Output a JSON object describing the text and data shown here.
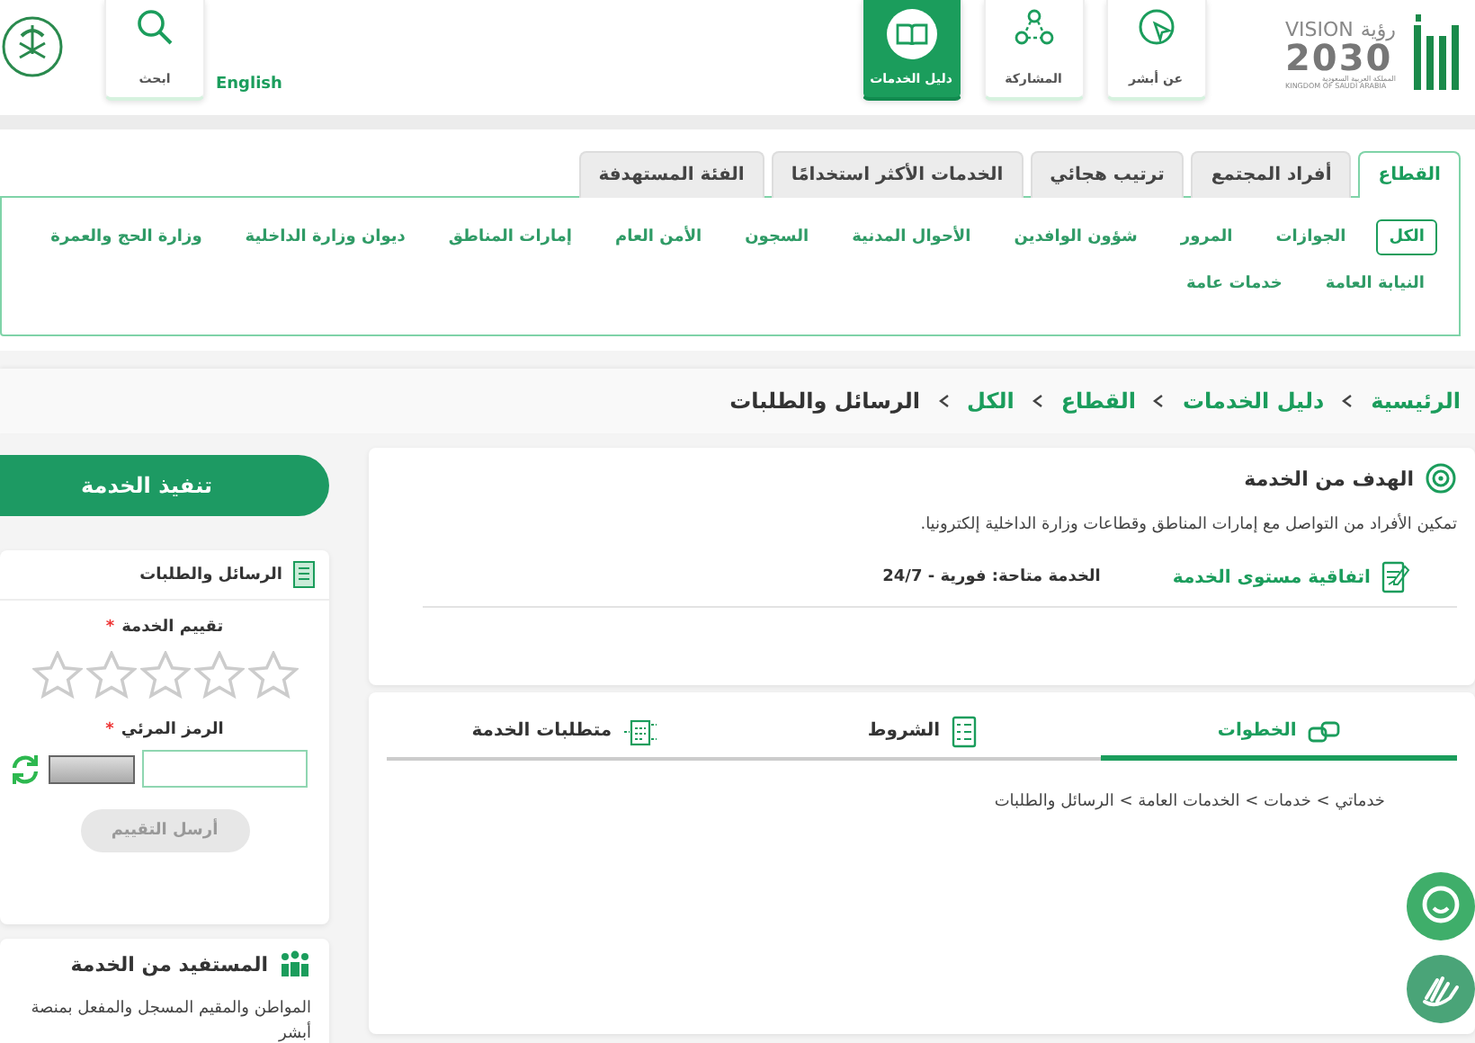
{
  "header": {
    "vision_logo": {
      "arabic": "رؤية",
      "latin": "VISION",
      "year": "2030",
      "caption_ar": "المملكة العربية السعودية",
      "caption_en": "KINGDOM OF SAUDI ARABIA"
    },
    "nav": [
      {
        "label": "عن أبشر",
        "selected": false
      },
      {
        "label": "المشاركة",
        "selected": false
      },
      {
        "label": "دليل الخدمات",
        "selected": true
      }
    ],
    "language": "English",
    "search": {
      "label": "ابحث"
    }
  },
  "sector_tabs": [
    {
      "label": "القطاع",
      "selected": true
    },
    {
      "label": "أفراد المجتمع",
      "selected": false
    },
    {
      "label": "ترتيب هجائي",
      "selected": false
    },
    {
      "label": "الخدمات الأكثر استخدامًا",
      "selected": false
    },
    {
      "label": "الفئة المستهدفة",
      "selected": false
    }
  ],
  "filters": [
    {
      "label": "الكل",
      "selected": true
    },
    {
      "label": "الجوازات",
      "selected": false
    },
    {
      "label": "المرور",
      "selected": false
    },
    {
      "label": "شؤون الوافدين",
      "selected": false
    },
    {
      "label": "الأحوال المدنية",
      "selected": false
    },
    {
      "label": "السجون",
      "selected": false
    },
    {
      "label": "الأمن العام",
      "selected": false
    },
    {
      "label": "إمارات المناطق",
      "selected": false
    },
    {
      "label": "ديوان وزارة الداخلية",
      "selected": false
    },
    {
      "label": "وزارة الحج والعمرة",
      "selected": false
    },
    {
      "label": "النيابة العامة",
      "selected": false
    },
    {
      "label": "خدمات عامة",
      "selected": false
    }
  ],
  "breadcrumb": [
    {
      "label": "الرئيسية",
      "link": true
    },
    {
      "label": "دليل الخدمات",
      "link": true
    },
    {
      "label": "القطاع",
      "link": true
    },
    {
      "label": "الكل",
      "link": true
    },
    {
      "label": "الرسائل والطلبات",
      "link": false
    }
  ],
  "goal": {
    "title": "الهدف من الخدمة",
    "text": "تمكين الأفراد من التواصل مع إمارات المناطق وقطاعات وزارة الداخلية إلكترونيا.",
    "sla_label": "اتفاقية مستوى الخدمة",
    "sla_value": "الخدمة متاحة: فورية - 24/7"
  },
  "detail_tabs": [
    {
      "label": "الخطوات",
      "selected": true
    },
    {
      "label": "الشروط",
      "selected": false
    },
    {
      "label": "متطلبات الخدمة",
      "selected": false
    }
  ],
  "steps_text": "خدماتي > خدمات > الخدمات العامة > الرسائل والطلبات",
  "execute_button": "تنفيذ الخدمة",
  "rating": {
    "service_name": "الرسائل والطلبات",
    "rating_label": "تقييم الخدمة",
    "required_mark": "*",
    "stars": 0,
    "captcha_label": "الرمز المرئي",
    "captcha_required_mark": "*",
    "send_button": {
      "label": "أرسل التقييم",
      "disabled": true
    }
  },
  "beneficiary": {
    "title": "المستفيد من الخدمة",
    "text": "المواطن والمقيم المسجل والمفعل بمنصة أبشر"
  }
}
